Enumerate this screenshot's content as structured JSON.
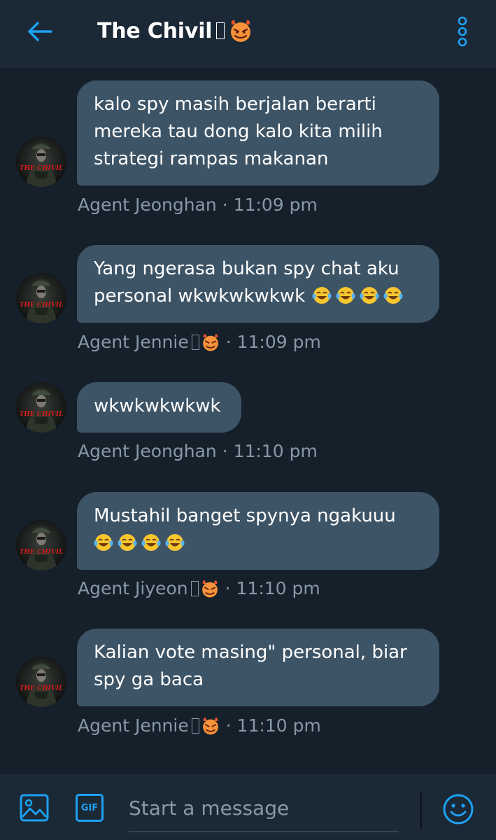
{
  "header": {
    "title": "The Chivil",
    "back_icon": "arrow-left-icon",
    "menu_icon": "vertical-dots-icon",
    "accent_color": "#1da1f2"
  },
  "messages": [
    {
      "text": "kalo spy masih berjalan berarti mereka tau dong kalo kita milih strategi rampas makanan",
      "sender": "Agent Jeonghan",
      "time": "11:09 pm"
    },
    {
      "text": "Yang ngerasa bukan spy chat aku personal wkwkwkwkwk",
      "sender": "Agent Jennie",
      "time": "11:09 pm",
      "emoji": "face-with-tears-of-joy x4"
    },
    {
      "text": "wkwkwkwkwk",
      "sender": "Agent Jeonghan",
      "time": "11:10 pm"
    },
    {
      "text": "Mustahil banget spynya ngakuuu",
      "sender": "Agent Jiyeon",
      "time": "11:10 pm",
      "emoji": "face-with-tears-of-joy x4"
    },
    {
      "text": "Kalian vote masing\" personal, biar spy ga baca",
      "sender": "Agent Jennie",
      "time": "11:10 pm"
    }
  ],
  "meta_separator": "·",
  "composer": {
    "placeholder": "Start a message",
    "image_icon": "image-icon",
    "gif_label": "GIF",
    "emoji_icon": "smiley-icon"
  }
}
